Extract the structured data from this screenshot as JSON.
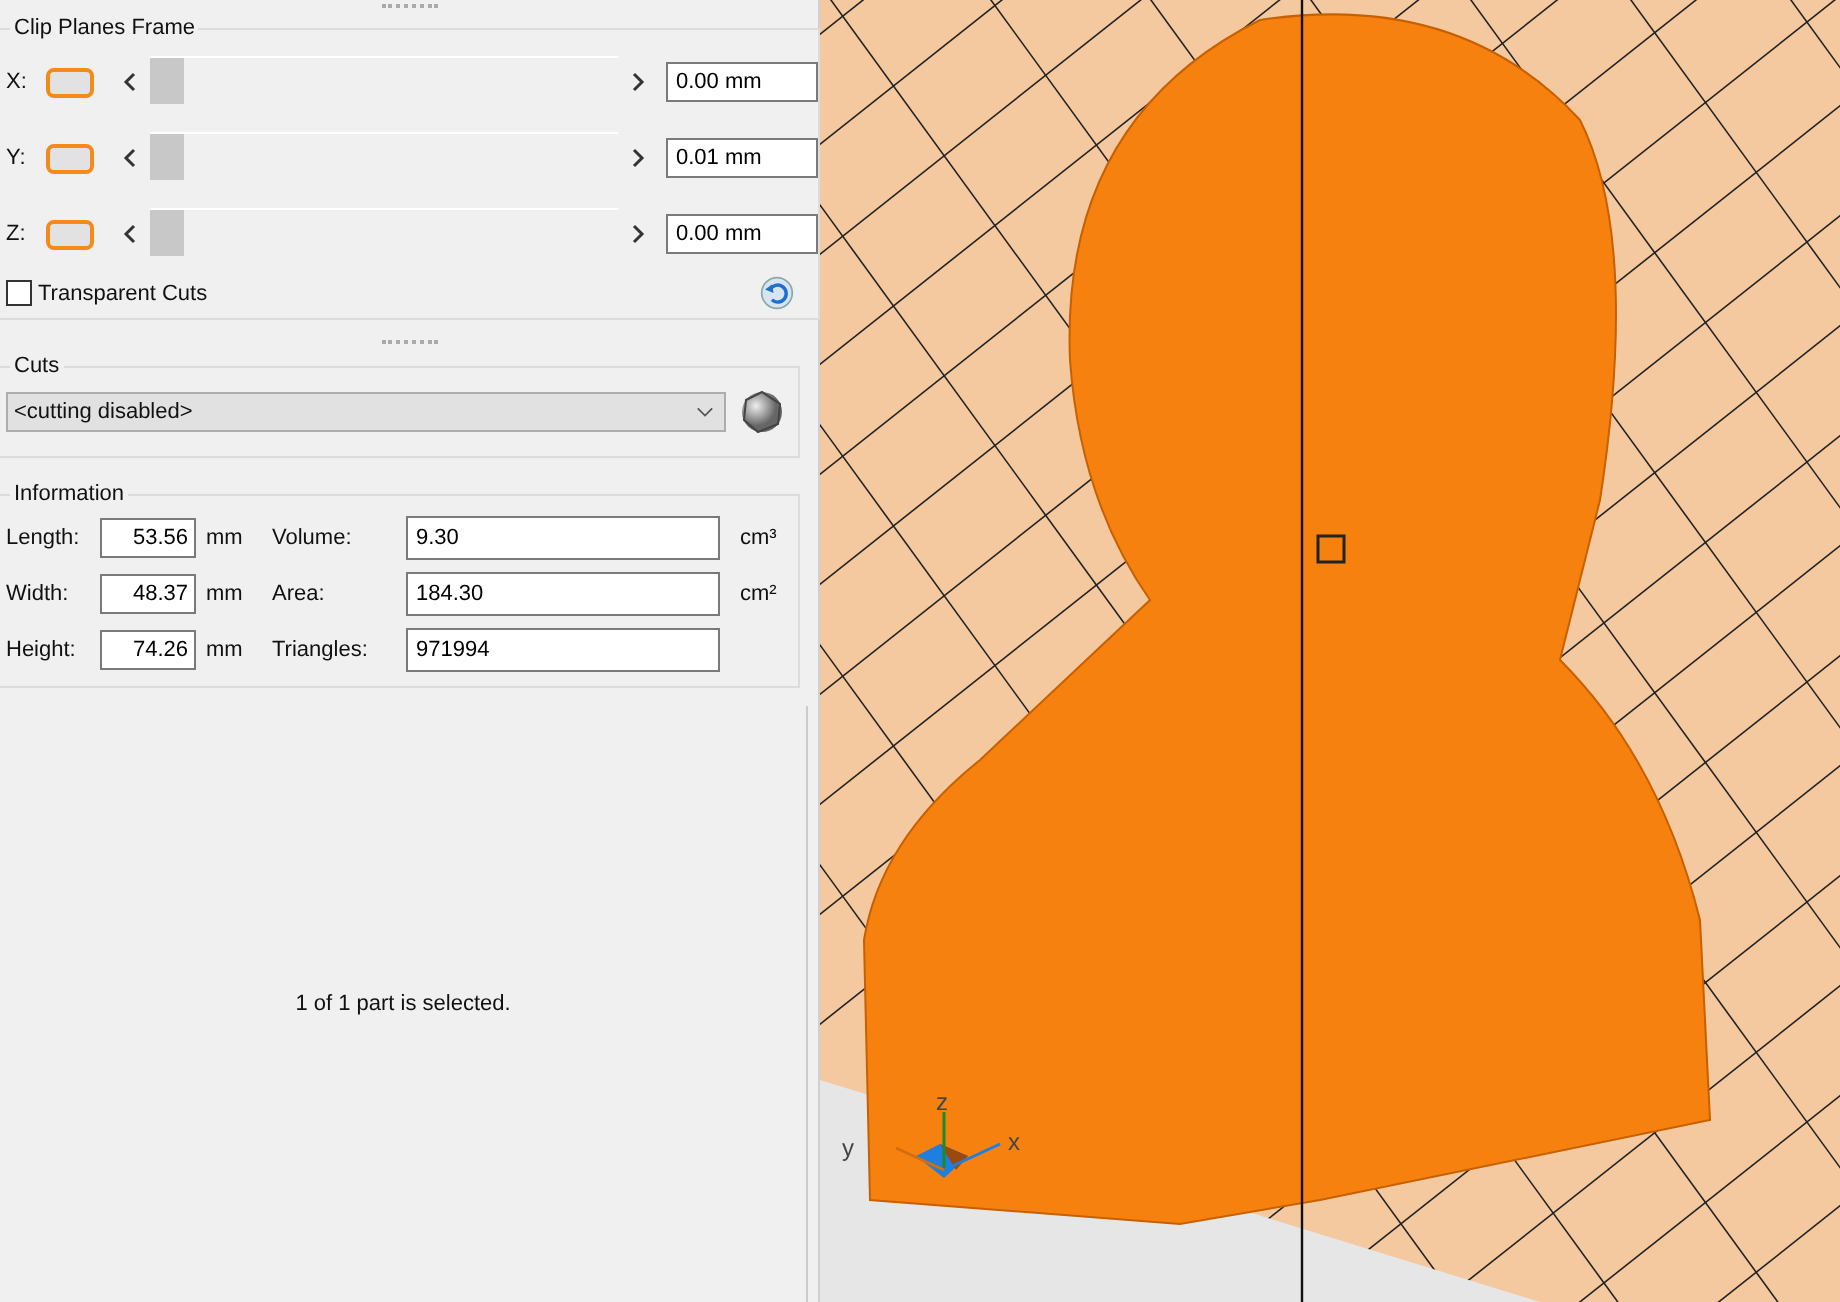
{
  "clip_planes": {
    "title": "Clip Planes Frame",
    "axes": [
      {
        "label": "X:",
        "level": 0,
        "value": "0.00 mm"
      },
      {
        "label": "Y:",
        "level": 0,
        "value": "0.01 mm"
      },
      {
        "label": "Z:",
        "level": 0,
        "value": "0.00 mm"
      }
    ],
    "transparent_cuts": {
      "label": "Transparent Cuts",
      "checked": false
    }
  },
  "cuts": {
    "title": "Cuts",
    "dropdown": {
      "value": "<cutting disabled>"
    }
  },
  "information": {
    "title": "Information",
    "rows": [
      {
        "label": "Length:",
        "value": "53.56",
        "unit": "mm",
        "stat_label": "Volume:",
        "stat_value": "9.30",
        "stat_unit": "cm³"
      },
      {
        "label": "Width:",
        "value": "48.37",
        "unit": "mm",
        "stat_label": "Area:",
        "stat_value": "184.30",
        "stat_unit": "cm²"
      },
      {
        "label": "Height:",
        "value": "74.26",
        "unit": "mm",
        "stat_label": "Triangles:",
        "stat_value": "971994",
        "stat_unit": ""
      }
    ]
  },
  "status": "1 of 1 part is selected.",
  "viewport": {
    "axis_labels": [
      "z",
      "y",
      "x"
    ]
  }
}
